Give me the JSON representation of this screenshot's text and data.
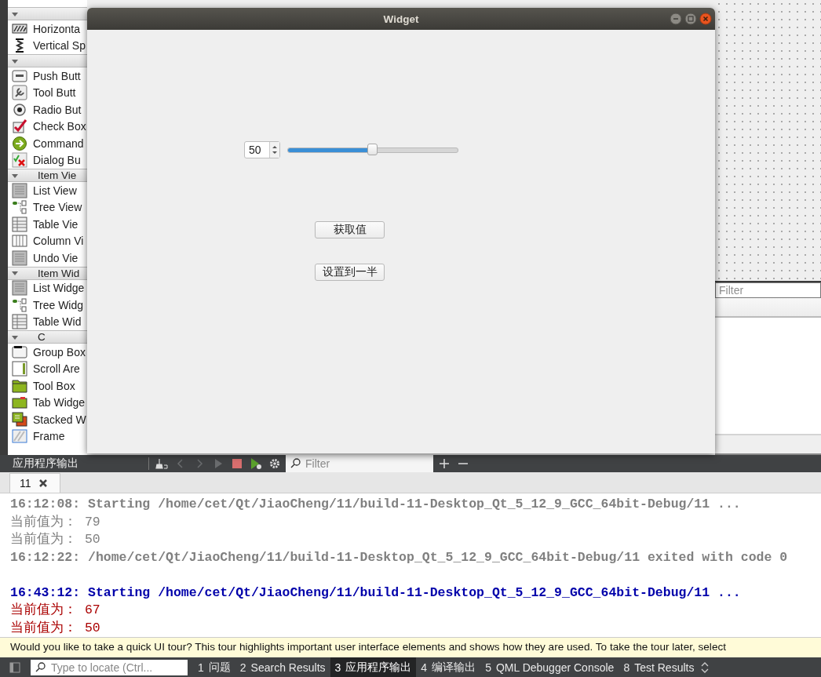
{
  "widget_box": {
    "sections": [
      {
        "expanded": true,
        "items": [
          "Horizonta",
          "Vertical Sp"
        ]
      },
      {
        "expanded": true,
        "items": [
          "Push Butt",
          "Tool Butt",
          "Radio But",
          "Check Box",
          "Command",
          "Dialog Bu"
        ]
      },
      {
        "title": "Item Vie",
        "expanded": true,
        "items": [
          "List View",
          "Tree View",
          "Table Vie",
          "Column Vi",
          "Undo Vie"
        ]
      },
      {
        "title": "Item Wid",
        "expanded": true,
        "items": [
          "List Widge",
          "Tree Widg",
          "Table Wid"
        ]
      },
      {
        "title": "C",
        "expanded": true,
        "items": [
          "Group Box",
          "Scroll Are",
          "Tool Box",
          "Tab Widge",
          "Stacked W",
          "Frame"
        ]
      }
    ]
  },
  "widget_window": {
    "title": "Widget",
    "spin_box": {
      "value": "50"
    },
    "slider": {
      "level": 0.5
    },
    "buttons": [
      "获取值",
      "设置到一半"
    ]
  },
  "property_filter": {
    "placeholder": "Filter"
  },
  "output_pane": {
    "title": "应用程序输出",
    "filter": {
      "placeholder": "Filter"
    },
    "tabs": [
      {
        "label": "11",
        "selected": true
      }
    ],
    "lines": [
      {
        "kind": "old-message",
        "text": "16:12:08: Starting /home/cet/Qt/JiaoCheng/11/build-11-Desktop_Qt_5_12_9_GCC_64bit-Debug/11 ..."
      },
      {
        "kind": "old-output",
        "text": "当前值为： 79"
      },
      {
        "kind": "old-output",
        "text": "当前值为： 50"
      },
      {
        "kind": "old-message",
        "text": "16:12:22: /home/cet/Qt/JiaoCheng/11/build-11-Desktop_Qt_5_12_9_GCC_64bit-Debug/11 exited with code 0"
      },
      {
        "kind": "separator"
      },
      {
        "kind": "message",
        "text": "16:43:12: Starting /home/cet/Qt/JiaoCheng/11/build-11-Desktop_Qt_5_12_9_GCC_64bit-Debug/11 ..."
      },
      {
        "kind": "output",
        "text": "当前值为： 67"
      },
      {
        "kind": "output",
        "text": "当前值为： 50"
      }
    ]
  },
  "hint_bar": {
    "text": "Would you like to take a quick UI tour? This tour highlights important user interface elements and shows how they are used. To take the tour later, select"
  },
  "status_bar": {
    "locate": {
      "placeholder": "Type to locate (Ctrl..."
    },
    "tabs": [
      {
        "number": "1",
        "label": "问题",
        "selected": false
      },
      {
        "number": "2",
        "label": "Search Results",
        "selected": false
      },
      {
        "number": "3",
        "label": "应用程序输出",
        "selected": true
      },
      {
        "number": "4",
        "label": "编译输出",
        "selected": false
      },
      {
        "number": "5",
        "label": "QML Debugger Console",
        "selected": false
      },
      {
        "number": "8",
        "label": "Test Results",
        "selected": false
      }
    ]
  }
}
